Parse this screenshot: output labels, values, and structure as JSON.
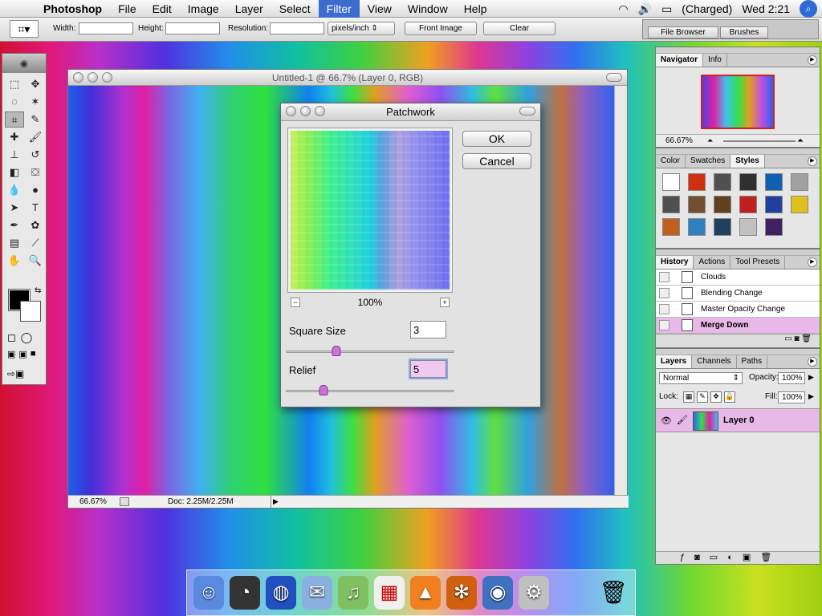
{
  "menubar": {
    "app_name": "Photoshop",
    "menus": [
      "File",
      "Edit",
      "Image",
      "Layer",
      "Select",
      "Filter",
      "View",
      "Window",
      "Help"
    ],
    "active_menu": "Filter",
    "battery": "(Charged)",
    "clock": "Wed 2:21"
  },
  "options_bar": {
    "width_label": "Width:",
    "width_value": "",
    "height_label": "Height:",
    "height_value": "",
    "resolution_label": "Resolution:",
    "resolution_value": "",
    "unit": "pixels/inch",
    "front_image": "Front Image",
    "clear": "Clear",
    "well_tabs": [
      "File Browser",
      "Brushes"
    ]
  },
  "document": {
    "title": "Untitled-1 @ 66.7% (Layer 0, RGB)",
    "zoom": "66.67%",
    "doc_size": "Doc: 2.25M/2.25M"
  },
  "dialog": {
    "title": "Patchwork",
    "zoom": "100%",
    "ok": "OK",
    "cancel": "Cancel",
    "square_size_label": "Square Size",
    "square_size_value": "3",
    "square_size_pos": 0.3,
    "relief_label": "Relief",
    "relief_value": "5",
    "relief_pos": 0.22
  },
  "navigator": {
    "tabs": [
      "Navigator",
      "Info"
    ],
    "zoom": "66.67%"
  },
  "styles": {
    "tabs": [
      "Color",
      "Swatches",
      "Styles"
    ],
    "colors": [
      "#ffffff",
      "#d03010",
      "#505050",
      "#303030",
      "#1060b0",
      "#a0a0a0",
      "#505050",
      "#705030",
      "#604020",
      "#c02020",
      "#2040a0",
      "#e0c020",
      "#c06020",
      "#3080c0",
      "#204060",
      "#c0c0c0",
      "#402060"
    ]
  },
  "history": {
    "tabs": [
      "History",
      "Actions",
      "Tool Presets"
    ],
    "items": [
      "Clouds",
      "Blending Change",
      "Master Opacity Change",
      "Merge Down"
    ]
  },
  "layers": {
    "tabs": [
      "Layers",
      "Channels",
      "Paths"
    ],
    "blend_mode": "Normal",
    "opacity_label": "Opacity:",
    "opacity": "100%",
    "lock_label": "Lock:",
    "fill_label": "Fill:",
    "fill": "100%",
    "layer_name": "Layer 0"
  }
}
